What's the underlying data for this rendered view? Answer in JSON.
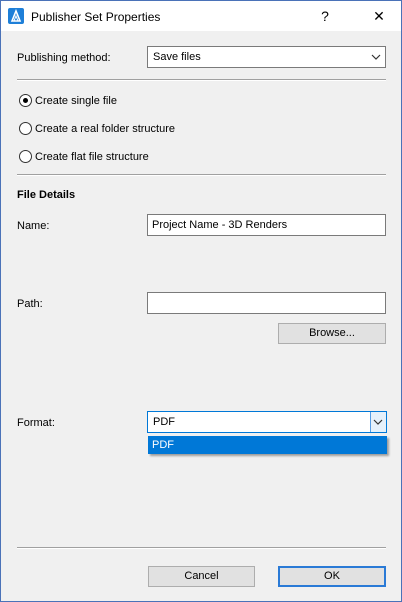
{
  "window": {
    "title": "Publisher Set Properties",
    "help_label": "?",
    "close_label": "✕"
  },
  "publishing": {
    "label": "Publishing method:",
    "value": "Save files"
  },
  "structure_options": [
    {
      "label": "Create single file",
      "checked": true
    },
    {
      "label": "Create a real folder structure",
      "checked": false
    },
    {
      "label": "Create flat file structure",
      "checked": false
    }
  ],
  "file_details": {
    "heading": "File Details",
    "name_label": "Name:",
    "name_value": "Project Name - 3D Renders",
    "path_label": "Path:",
    "path_value": "",
    "browse_label": "Browse...",
    "format_label": "Format:",
    "format_value": "PDF",
    "format_options": [
      "PDF"
    ]
  },
  "footer": {
    "cancel_label": "Cancel",
    "ok_label": "OK"
  },
  "colors": {
    "accent": "#0078d7",
    "app_icon": "#1e7fd8",
    "window_border": "#4a72b8"
  }
}
